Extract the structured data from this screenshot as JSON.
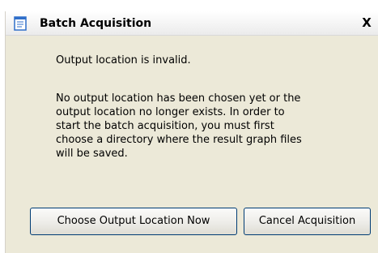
{
  "window": {
    "title": "Batch Acquisition",
    "close_glyph": "X"
  },
  "message": {
    "title": "Output location is invalid.",
    "body_lines": [
      "No output location has been chosen yet or the",
      "output location no longer exists.  In order to",
      "start the batch acquisition, you must first",
      "choose a directory where the result graph files",
      "will be saved."
    ]
  },
  "buttons": {
    "choose_label": "Choose Output Location Now",
    "cancel_label": "Cancel Acquisition"
  },
  "icons": {
    "title": "document-icon"
  },
  "colors": {
    "dialog_background": "#ece9d8",
    "button_border": "#003c74",
    "icon_blue": "#2f6ec9"
  }
}
